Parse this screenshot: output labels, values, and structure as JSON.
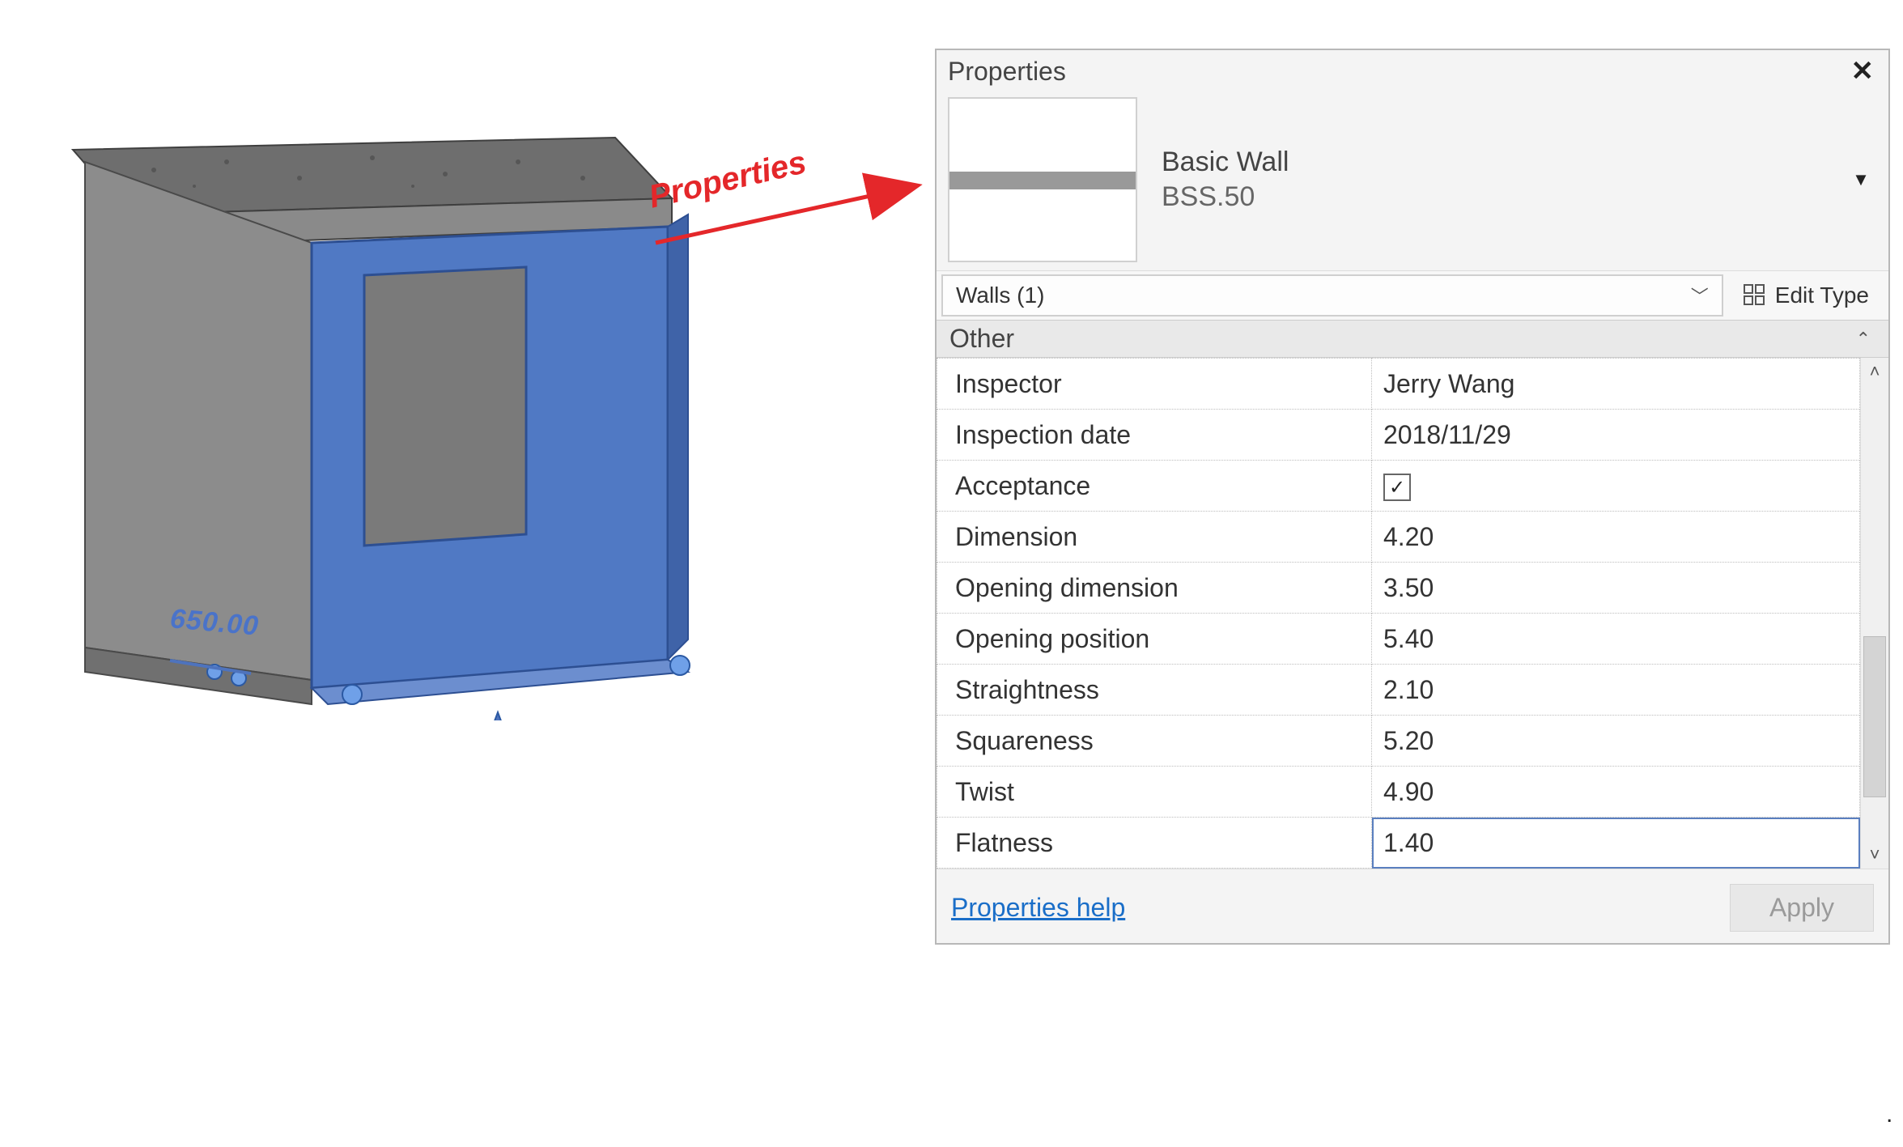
{
  "annotation": {
    "label": "Properties"
  },
  "model": {
    "dimension_label": "650.00"
  },
  "panel": {
    "title": "Properties",
    "type_family": "Basic Wall",
    "type_name": "BSS.50",
    "selector_label": "Walls (1)",
    "edit_type_label": "Edit Type",
    "group_header": "Other",
    "help_link": "Properties help",
    "apply_label": "Apply",
    "props": [
      {
        "label": "Inspector",
        "value": "Jerry Wang",
        "kind": "text"
      },
      {
        "label": "Inspection date",
        "value": "2018/11/29",
        "kind": "text"
      },
      {
        "label": "Acceptance",
        "value": "checked",
        "kind": "check"
      },
      {
        "label": "Dimension",
        "value": "4.20",
        "kind": "text"
      },
      {
        "label": "Opening dimension",
        "value": "3.50",
        "kind": "text"
      },
      {
        "label": "Opening position",
        "value": "5.40",
        "kind": "text"
      },
      {
        "label": "Straightness",
        "value": "2.10",
        "kind": "text"
      },
      {
        "label": "Squareness",
        "value": "5.20",
        "kind": "text"
      },
      {
        "label": "Twist",
        "value": "4.90",
        "kind": "text"
      },
      {
        "label": "Flatness",
        "value": "1.40",
        "kind": "text",
        "active": true
      }
    ]
  }
}
